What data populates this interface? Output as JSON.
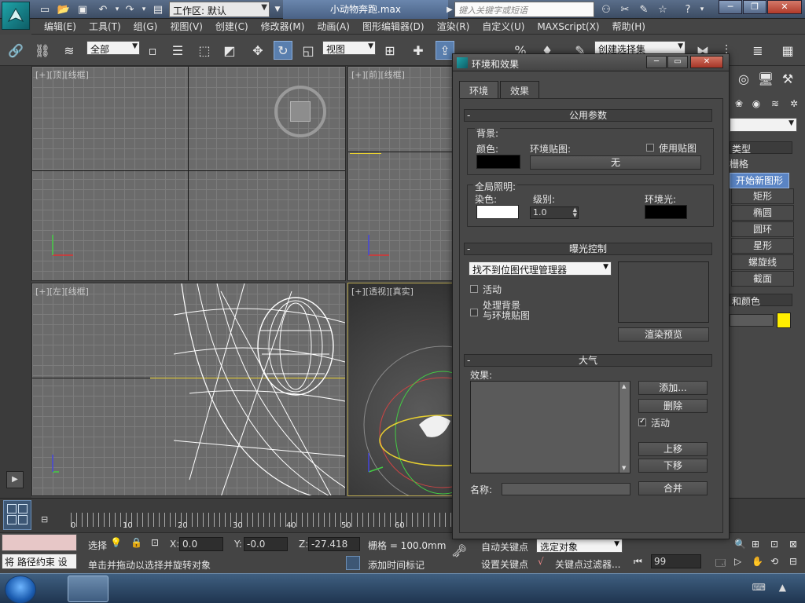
{
  "window": {
    "workspace_label": "工作区: 默认",
    "document_title": "小动物奔跑.max",
    "search_placeholder": "键入关键字或短语"
  },
  "menu": [
    "编辑(E)",
    "工具(T)",
    "组(G)",
    "视图(V)",
    "创建(C)",
    "修改器(M)",
    "动画(A)",
    "图形编辑器(D)",
    "渲染(R)",
    "自定义(U)",
    "MAXScript(X)",
    "帮助(H)"
  ],
  "toolbar": {
    "selection_filter": "全部",
    "reference_coord": "视图",
    "named_selection": "创建选择集",
    "snap_value": "3"
  },
  "viewports": {
    "top": "[+][顶][线框]",
    "front": "[+][前][线框]",
    "left": "[+][左][线框]",
    "perspective": "[+][透视][真实]"
  },
  "timeline": {
    "ticks": [
      "0",
      "10",
      "20",
      "30",
      "40",
      "50",
      "60"
    ]
  },
  "status": {
    "script_line": "将 路径约束 设",
    "prompt": "单击并拖动以选择并旋转对象",
    "select_label": "选择",
    "x_value": "0.0",
    "y_value": "-0.0",
    "z_value": "-27.418",
    "grid_label": "栅格 = 100.0mm",
    "add_time_tag": "添加时间标记",
    "auto_key": "自动关键点",
    "selected_objects": "选定对象",
    "set_key": "设置关键点",
    "key_filters": "关键点过滤器...",
    "frame": "99"
  },
  "command_panel": {
    "type_header": "类型",
    "grid_label": "栅格",
    "start_new_shape": "开始新图形",
    "items": [
      "矩形",
      "椭圆",
      "圆环",
      "星形",
      "螺旋线",
      "截面"
    ],
    "name_color": "和颜色"
  },
  "dialog": {
    "title": "环境和效果",
    "tabs": [
      "环境",
      "效果"
    ],
    "common_params": {
      "header": "公用参数",
      "background_label": "背景:",
      "color_label": "颜色:",
      "env_map_label": "环境贴图:",
      "use_map_label": "使用贴图",
      "none_button": "无",
      "global_lighting_label": "全局照明:",
      "tint_label": "染色:",
      "level_label": "级别:",
      "level_value": "1.0",
      "ambient_label": "环境光:"
    },
    "exposure": {
      "header": "曝光控制",
      "selected": "找不到位图代理管理器",
      "active_label": "活动",
      "process_bg_line1": "处理背景",
      "process_bg_line2": "与环境贴图",
      "render_preview": "渲染预览"
    },
    "atmosphere": {
      "header": "大气",
      "effects_label": "效果:",
      "add": "添加...",
      "delete": "删除",
      "active_label": "活动",
      "move_up": "上移",
      "move_down": "下移",
      "name_label": "名称:",
      "merge": "合并"
    }
  },
  "colors": {
    "background_swatch": "#000000",
    "tint_swatch": "#ffffff",
    "ambient_swatch": "#000000",
    "object_color": "#ffee00",
    "accent": "#5a7fae"
  }
}
